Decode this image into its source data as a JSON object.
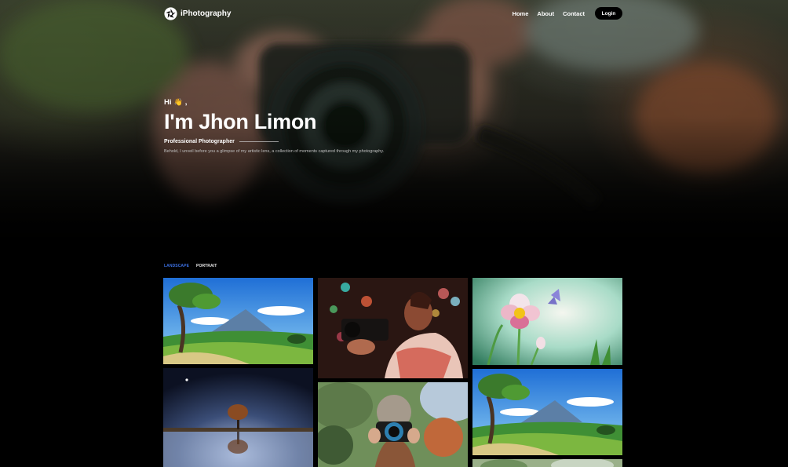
{
  "brand": {
    "name": "iPhotography",
    "logo_icon": "aperture-icon"
  },
  "nav": {
    "links": [
      {
        "label": "Home"
      },
      {
        "label": "About"
      },
      {
        "label": "Contact"
      }
    ],
    "login_label": "Login"
  },
  "hero": {
    "greeting": "Hi",
    "greeting_icon": "👋",
    "greeting_suffix": ",",
    "name": "I'm Jhon Limon",
    "role": "Professional Photographer",
    "tagline": "Behold, I unveil before you a glimpse of my artistic lens, a collection of moments captured through my photography."
  },
  "filters": {
    "tabs": [
      {
        "label": "LANDSCAPE",
        "active": true
      },
      {
        "label": "PORTRAIT",
        "active": false
      }
    ]
  },
  "colors": {
    "accent": "#3b6fe0",
    "background": "#000000",
    "text": "#ffffff"
  }
}
